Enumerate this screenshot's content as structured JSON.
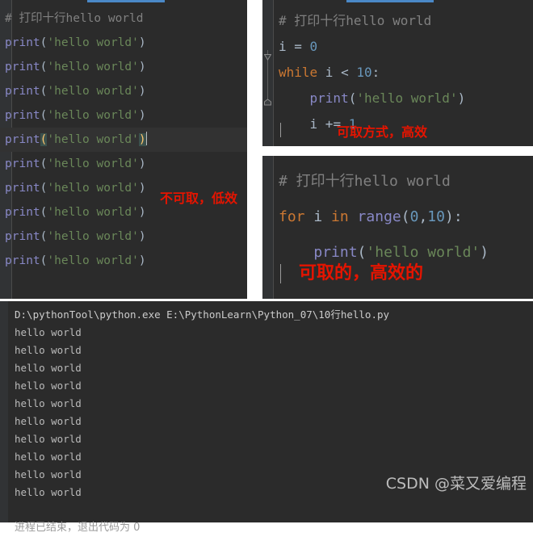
{
  "editors": {
    "left": {
      "name": "ten-prints-editor",
      "comment": "# 打印十行hello world",
      "print_statement": "print('hello world')",
      "print_count": 10,
      "caret_line_index": 5,
      "string_literal": "'hello world'",
      "func_name": "print",
      "open_paren": "(",
      "close_paren": ")"
    },
    "while": {
      "name": "while-loop-editor",
      "lines": [
        {
          "kind": "comment",
          "text": "# 打印十行hello world"
        },
        {
          "kind": "assign",
          "var": "i",
          "op": "=",
          "value": "0"
        },
        {
          "kind": "while",
          "keyword": "while",
          "var": "i",
          "op": "<",
          "value": "10",
          "colon": ":"
        },
        {
          "kind": "print",
          "indent": "    ",
          "func": "print",
          "string": "'hello world'"
        },
        {
          "kind": "incr",
          "indent": "    ",
          "var": "i",
          "op": "+=",
          "value": "1"
        }
      ]
    },
    "for": {
      "name": "for-loop-editor",
      "lines": [
        {
          "kind": "comment",
          "text": "# 打印十行hello world"
        },
        {
          "kind": "for",
          "kw_for": "for",
          "var": "i",
          "kw_in": "in",
          "func": "range",
          "arg0": "0",
          "comma": ",",
          "arg1": "10",
          "colon": ":"
        },
        {
          "kind": "print",
          "indent": "    ",
          "func": "print",
          "string": "'hello world'"
        }
      ]
    }
  },
  "annotations": {
    "left": "不可取，低效",
    "while": "可取方式，高效",
    "for": "可取的，高效的",
    "color": "#e51400"
  },
  "console": {
    "name": "run-console",
    "command": "D:\\pythonTool\\python.exe E:\\PythonLearn\\Python_07\\10行hello.py",
    "output_line": "hello world",
    "output_count": 10,
    "exit_message": "进程已结束，退出代码为 0"
  },
  "watermark": {
    "text": "CSDN @菜又爱编程"
  },
  "theme": {
    "editor_bg": "#2b2b2b",
    "gutter_bg": "#313335",
    "caret_line_bg": "#323232",
    "text": "#a9b7c6",
    "comment": "#808080",
    "string": "#6a8759",
    "keyword": "#cc7832",
    "number": "#6897bb",
    "function": "#8888c6",
    "tab_indicator": "#4a88c7"
  }
}
